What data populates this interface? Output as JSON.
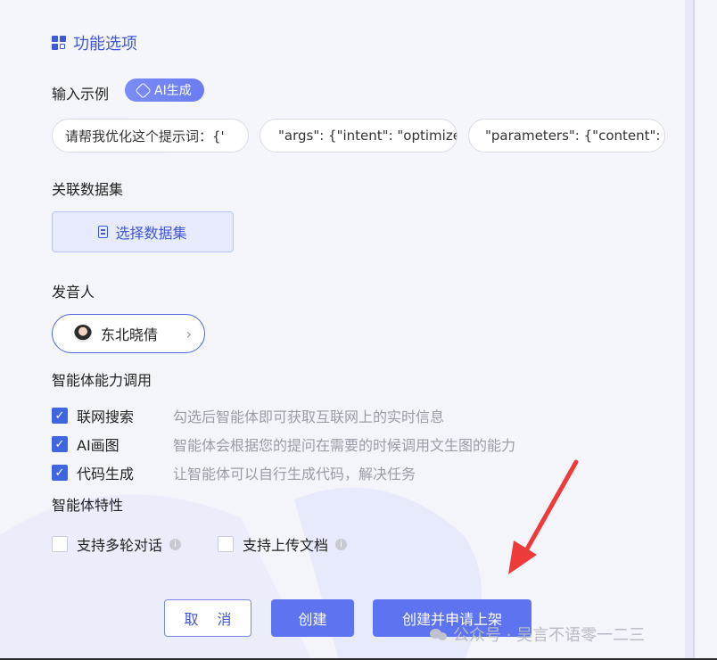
{
  "section": {
    "icon": "grid-icon",
    "title": "功能选项"
  },
  "input_examples": {
    "label": "输入示例",
    "ai_button": "AI生成",
    "items": [
      "请帮我优化这个提示词：{'",
      "\"args\": {\"intent\": \"optimize",
      "\"parameters\": {\"content\":"
    ]
  },
  "dataset": {
    "label": "关联数据集",
    "button": "选择数据集"
  },
  "speaker": {
    "label": "发音人",
    "name": "东北晓倩",
    "chevron": "›"
  },
  "capabilities": {
    "label": "智能体能力调用",
    "items": [
      {
        "name": "联网搜索",
        "desc": "勾选后智能体即可获取互联网上的实时信息",
        "checked": true
      },
      {
        "name": "AI画图",
        "desc": "智能体会根据您的提问在需要的时候调用文生图的能力",
        "checked": true
      },
      {
        "name": "代码生成",
        "desc": "让智能体可以自行生成代码，解决任务",
        "checked": true
      }
    ]
  },
  "features": {
    "label": "智能体特性",
    "items": [
      {
        "name": "支持多轮对话",
        "checked": false
      },
      {
        "name": "支持上传文档",
        "checked": false
      }
    ]
  },
  "buttons": {
    "cancel": "取 消",
    "create": "创建",
    "create_publish": "创建并申请上架"
  },
  "watermark": "公众号 · 吴言不语零一二三",
  "colors": {
    "accent": "#3f57d8",
    "primary_button": "#5d73f0",
    "arrow": "#ee3a3a"
  }
}
